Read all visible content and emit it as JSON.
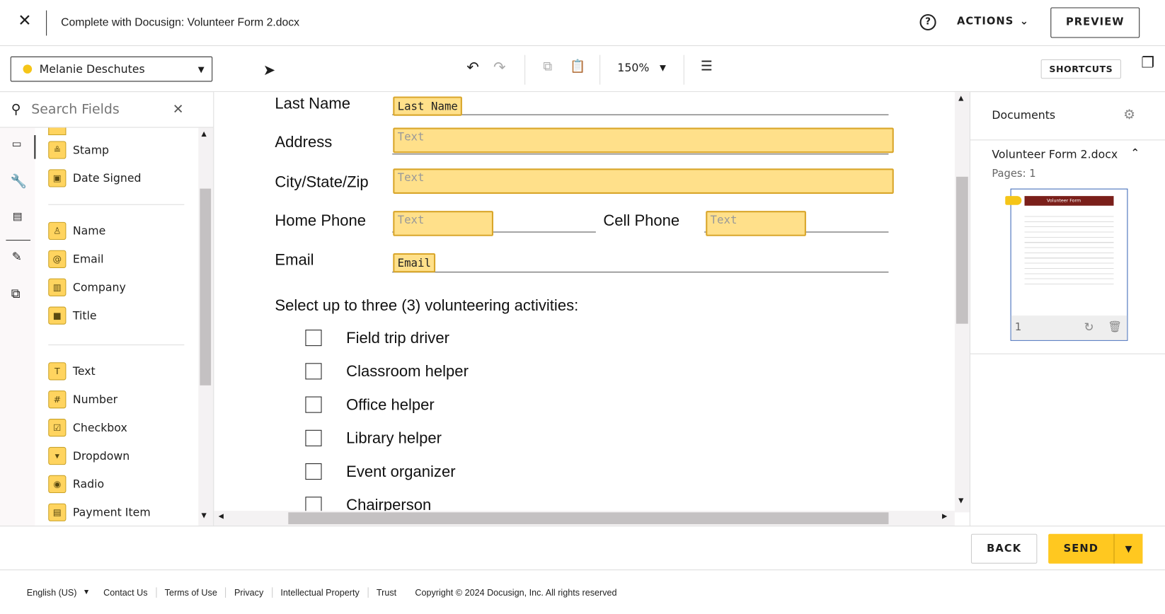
{
  "header": {
    "title": "Complete with Docusign: Volunteer Form 2.docx",
    "actions_label": "ACTIONS",
    "preview_label": "PREVIEW"
  },
  "toolbar": {
    "recipient": "Melanie Deschutes",
    "recipient_color": "#f5c518",
    "zoom": "150%",
    "shortcuts_label": "SHORTCUTS"
  },
  "search": {
    "placeholder": "Search Fields"
  },
  "fields": {
    "group1": [
      {
        "label": "Stamp",
        "icon": "stamp-icon"
      },
      {
        "label": "Date Signed",
        "icon": "calendar-icon"
      }
    ],
    "group2": [
      {
        "label": "Name",
        "icon": "person-icon"
      },
      {
        "label": "Email",
        "icon": "at-icon"
      },
      {
        "label": "Company",
        "icon": "building-icon"
      },
      {
        "label": "Title",
        "icon": "briefcase-icon"
      }
    ],
    "group3": [
      {
        "label": "Text",
        "icon": "text-icon"
      },
      {
        "label": "Number",
        "icon": "hash-icon"
      },
      {
        "label": "Checkbox",
        "icon": "checkbox-icon"
      },
      {
        "label": "Dropdown",
        "icon": "dropdown-icon"
      },
      {
        "label": "Radio",
        "icon": "radio-icon"
      },
      {
        "label": "Payment Item",
        "icon": "payment-icon"
      }
    ]
  },
  "document": {
    "labels": {
      "last_name": "Last Name",
      "address": "Address",
      "city": "City/State/Zip",
      "home_phone": "Home Phone",
      "cell_phone": "Cell Phone",
      "email": "Email"
    },
    "tags": {
      "last_name": "Last Name",
      "address": "Text",
      "city": "Text",
      "home_phone": "Text",
      "cell_phone": "Text",
      "email": "Email"
    },
    "activities_heading": "Select up to three (3) volunteering activities:",
    "activities": [
      "Field trip driver",
      "Classroom helper",
      "Office helper",
      "Library helper",
      "Event organizer",
      "Chairperson"
    ]
  },
  "right_panel": {
    "title": "Documents",
    "doc_name": "Volunteer Form 2.docx",
    "pages": "Pages: 1",
    "thumb_title": "Volunteer Form",
    "page_number": "1"
  },
  "actions": {
    "back": "BACK",
    "send": "SEND"
  },
  "footer": {
    "language": "English (US)",
    "links": [
      "Contact Us",
      "Terms of Use",
      "Privacy",
      "Intellectual Property",
      "Trust"
    ],
    "copyright": "Copyright © 2024 Docusign, Inc. All rights reserved"
  }
}
